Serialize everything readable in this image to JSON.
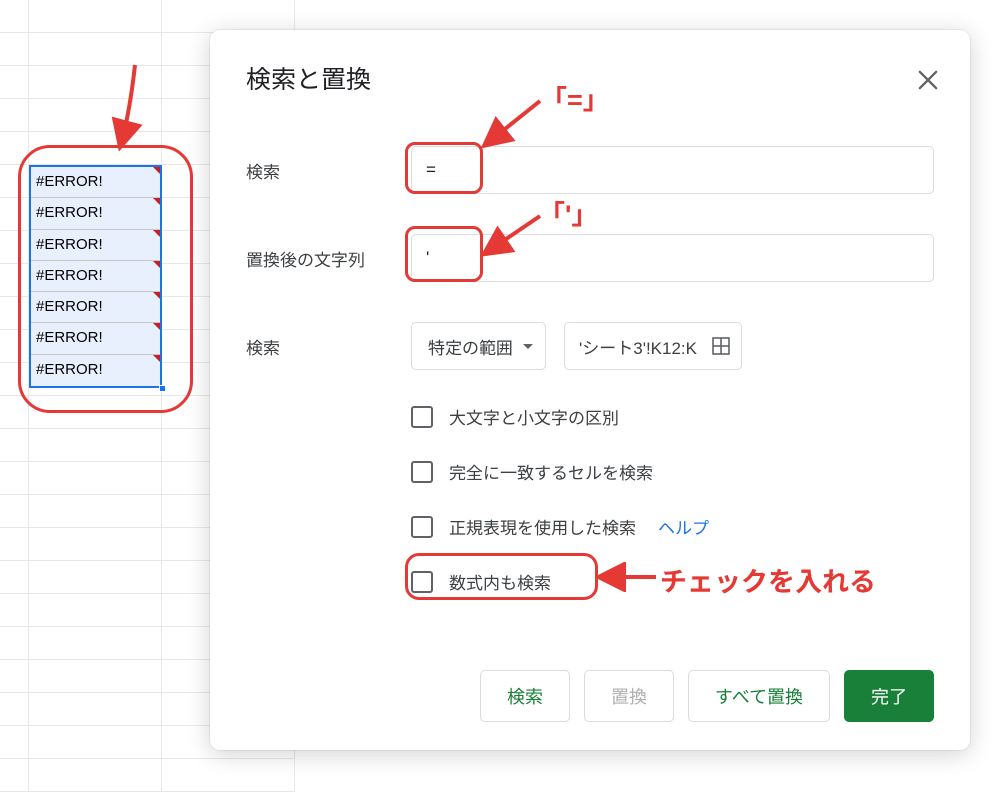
{
  "errors": [
    "#ERROR!",
    "#ERROR!",
    "#ERROR!",
    "#ERROR!",
    "#ERROR!",
    "#ERROR!",
    "#ERROR!"
  ],
  "dialog": {
    "title": "検索と置換",
    "search_label": "検索",
    "search_value": "=",
    "replace_label": "置換後の文字列",
    "replace_value": "'",
    "scope_label": "検索",
    "scope_dropdown": "特定の範囲",
    "range_value": "'シート3'!K12:K",
    "checks": {
      "c1": "大文字と小文字の区別",
      "c2": "完全に一致するセルを検索",
      "c3": "正規表現を使用した検索",
      "c3_help": "ヘルプ",
      "c4": "数式内も検索"
    },
    "buttons": {
      "find": "検索",
      "replace": "置換",
      "replace_all": "すべて置換",
      "done": "完了"
    }
  },
  "annotations": {
    "equals_label": "「=」",
    "apostrophe_label": "「'」",
    "check_label": "チェックを入れる"
  }
}
